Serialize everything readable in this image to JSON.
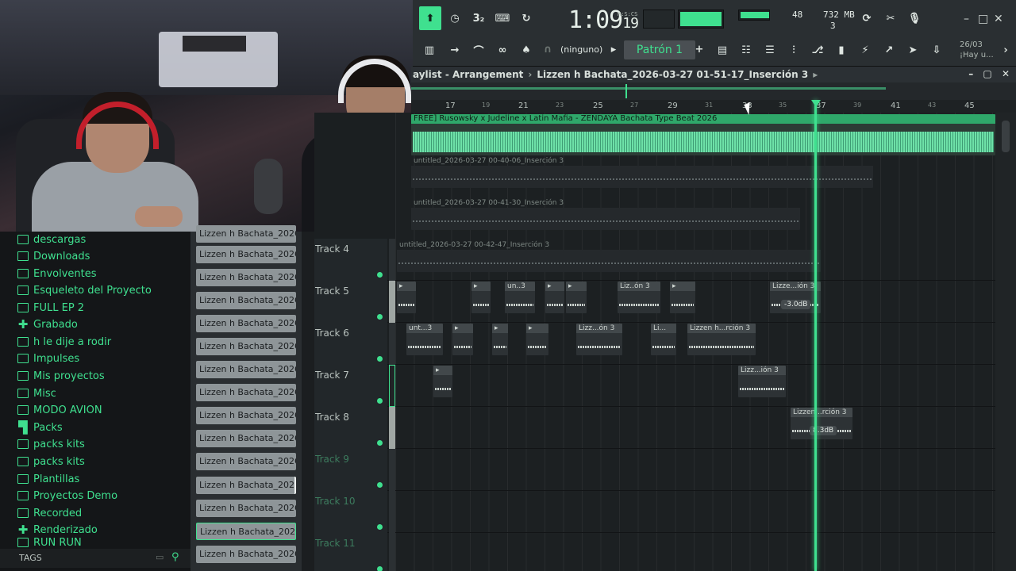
{
  "toolbar": {
    "time": "1:09",
    "time_ms": "19",
    "time_unit": "M:S:CS",
    "cpu_val": "48",
    "mem_val": "732 MB",
    "voices": "3",
    "pattern_label": "Patrón 1",
    "channel_label": "(ninguno)",
    "date": "26/03",
    "hint": "¡Hay u...",
    "transport_buttons": [
      "pattern-song",
      "metronome",
      "typing-keyboard",
      "countdown",
      "loop-record"
    ]
  },
  "playlist": {
    "title_a": "aylist - Arrangement",
    "title_b": "Lizzen h Bachata_2026-03-27 01-51-17_Inserción 3",
    "ruler": [
      "17",
      "19",
      "21",
      "23",
      "25",
      "27",
      "29",
      "31",
      "33",
      "35",
      "37",
      "39",
      "41",
      "43",
      "45"
    ],
    "tracks": [
      {
        "name": "Track 4"
      },
      {
        "name": "Track 5"
      },
      {
        "name": "Track 6"
      },
      {
        "name": "Track 7"
      },
      {
        "name": "Track 8"
      },
      {
        "name": "Track 9"
      },
      {
        "name": "Track 10"
      },
      {
        "name": "Track 11"
      }
    ],
    "main_clip": "FREE] Rusowsky x Judeline x Latin Mafia - ZENDAYA  Bachata Type Beat 2026",
    "clip_untitled_1": "untitled_2026-03-27 00-40-06_Inserción 3",
    "clip_untitled_2": "untitled_2026-03-27 00-41-30_Inserción 3",
    "clip_untitled_3": "untitled_2026-03-27 00-42-47_Inserción 3",
    "clip_labels": {
      "un3": "un..3",
      "liz_on3": "Liz..ón 3",
      "lizze_ion3": "Lizze...ión 3",
      "unt3": "unt...3",
      "lizz_on3": "Lizz...ón 3",
      "lizzen_rcion3": "Lizzen h...rción 3",
      "li": "Li...",
      "lizz_ion3": "Lizz...ión 3",
      "lizzen_rcion3b": "Lizzen...rción 3"
    },
    "gain_1": "-3.0dB",
    "gain_2": "8.3dB"
  },
  "browser": {
    "items": [
      {
        "label": "descargas",
        "icon": "folder-icon"
      },
      {
        "label": "Downloads",
        "icon": "folder-icon"
      },
      {
        "label": "Envolventes",
        "icon": "folder-icon"
      },
      {
        "label": "Esqueleto del Proyecto",
        "icon": "folder-icon"
      },
      {
        "label": "FULL EP 2",
        "icon": "folder-icon"
      },
      {
        "label": "Grabado",
        "icon": "plus-icon"
      },
      {
        "label": "h le dije a rodir",
        "icon": "folder-icon"
      },
      {
        "label": "Impulses",
        "icon": "folder-icon"
      },
      {
        "label": "Mis proyectos",
        "icon": "folder-icon"
      },
      {
        "label": "Misc",
        "icon": "folder-icon"
      },
      {
        "label": "MODO AVION",
        "icon": "folder-icon"
      },
      {
        "label": "Packs",
        "icon": "packs-icon"
      },
      {
        "label": "packs kits",
        "icon": "folder-icon"
      },
      {
        "label": "packs kits",
        "icon": "folder-icon"
      },
      {
        "label": "Plantillas",
        "icon": "folder-icon"
      },
      {
        "label": "Proyectos Demo",
        "icon": "folder-icon"
      },
      {
        "label": "Recorded",
        "icon": "folder-icon"
      },
      {
        "label": "Renderizado",
        "icon": "plus-icon"
      },
      {
        "label": "RUN RUN",
        "icon": "folder-icon"
      }
    ],
    "tags_label": "TAGS"
  },
  "files": {
    "items": [
      "Lizzen h Bachata_2026-0...",
      "Lizzen h Bachata_2026-0...",
      "Lizzen h Bachata_2026-0...",
      "Lizzen h Bachata_2026-0...",
      "Lizzen h Bachata_2026-0...",
      "Lizzen h Bachata_2026-0...",
      "Lizzen h Bachata_2026-0...",
      "Lizzen h Bachata_2026-0...",
      "Lizzen h Bachata_2026-0...",
      "Lizzen h Bachata_2026-0...",
      "Lizzen h Bachata_2026-0...",
      "Lizzen h Bachata_2026-0...",
      "Lizzen h Bachata_2026-0...",
      "Lizzen h Bachata_2026-0...",
      "Lizzen h Bachata_2026-0..."
    ]
  },
  "colors": {
    "accent": "#3fe08f",
    "background": "#1b1f21"
  }
}
